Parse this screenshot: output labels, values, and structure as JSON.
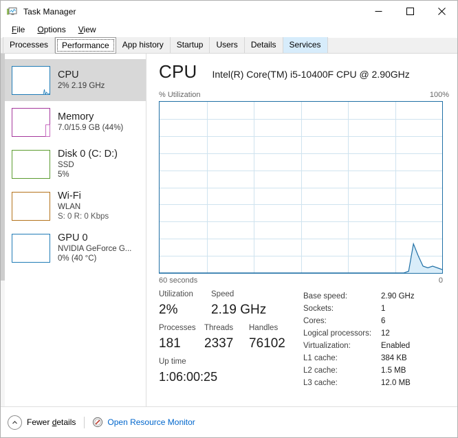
{
  "window": {
    "title": "Task Manager",
    "icon": "task-manager-icon",
    "minimize": "—",
    "maximize": "□",
    "close": "✕"
  },
  "menu": [
    {
      "label": "File",
      "accel": "F"
    },
    {
      "label": "Options",
      "accel": "O"
    },
    {
      "label": "View",
      "accel": "V"
    }
  ],
  "tabs": [
    {
      "label": "Processes",
      "state": "normal"
    },
    {
      "label": "Performance",
      "state": "active"
    },
    {
      "label": "App history",
      "state": "normal"
    },
    {
      "label": "Startup",
      "state": "normal"
    },
    {
      "label": "Users",
      "state": "normal"
    },
    {
      "label": "Details",
      "state": "normal"
    },
    {
      "label": "Services",
      "state": "hover"
    }
  ],
  "sidebar": {
    "items": [
      {
        "name": "CPU",
        "line2": "2%  2.19 GHz",
        "line3": "",
        "color": "#1f7bb6",
        "selected": true
      },
      {
        "name": "Memory",
        "line2": "7.0/15.9 GB (44%)",
        "line3": "",
        "color": "#a4379c",
        "selected": false
      },
      {
        "name": "Disk 0 (C: D:)",
        "line2": "SSD",
        "line3": "5%",
        "color": "#5b9b2e",
        "selected": false
      },
      {
        "name": "Wi-Fi",
        "line2": "WLAN",
        "line3": "S: 0 R: 0 Kbps",
        "color": "#b4721a",
        "selected": false
      },
      {
        "name": "GPU 0",
        "line2": "NVIDIA GeForce G...",
        "line3": "0%  (40 °C)",
        "color": "#1f7bb6",
        "selected": false
      }
    ]
  },
  "main": {
    "title": "CPU",
    "subtitle": "Intel(R) Core(TM) i5-10400F CPU @ 2.90GHz",
    "axis_label": "% Utilization",
    "axis_max": "100%",
    "time_left": "60 seconds",
    "time_right": "0",
    "accent_color": "#1f6fa5",
    "fill_color": "#d9edf9"
  },
  "chart_data": {
    "type": "area",
    "title": "CPU % Utilization",
    "xlabel": "60 seconds",
    "ylabel": "% Utilization",
    "ylim": [
      0,
      100
    ],
    "xlim": [
      60,
      0
    ],
    "grid": true,
    "grid_cols": 6,
    "grid_rows": 10,
    "legend": "none",
    "series": [
      {
        "name": "CPU utilization",
        "values": [
          0,
          0,
          0,
          0,
          0,
          0,
          0,
          0,
          0,
          0,
          0,
          0,
          0,
          0,
          0,
          0,
          0,
          0,
          0,
          0,
          0,
          0,
          0,
          0,
          0,
          0,
          0,
          0,
          0,
          0,
          0,
          0,
          0,
          0,
          0,
          0,
          0,
          0,
          0,
          0,
          0,
          0,
          0,
          0,
          0,
          0,
          0,
          0,
          0,
          0,
          0,
          0,
          1,
          17,
          10,
          4,
          3,
          4,
          3,
          2
        ]
      }
    ]
  },
  "stats": {
    "groups": [
      [
        {
          "label": "Utilization",
          "value": "2%"
        },
        {
          "label": "Speed",
          "value": "2.19 GHz"
        }
      ],
      [
        {
          "label": "Processes",
          "value": "181"
        },
        {
          "label": "Threads",
          "value": "2337"
        },
        {
          "label": "Handles",
          "value": "76102"
        }
      ],
      [
        {
          "label": "Up time",
          "value": "1:06:00:25"
        }
      ]
    ],
    "specs": [
      {
        "label": "Base speed:",
        "value": "2.90 GHz"
      },
      {
        "label": "Sockets:",
        "value": "1"
      },
      {
        "label": "Cores:",
        "value": "6"
      },
      {
        "label": "Logical processors:",
        "value": "12"
      },
      {
        "label": "Virtualization:",
        "value": "Enabled"
      },
      {
        "label": "L1 cache:",
        "value": "384 KB"
      },
      {
        "label": "L2 cache:",
        "value": "1.5 MB"
      },
      {
        "label": "L3 cache:",
        "value": "12.0 MB"
      }
    ]
  },
  "statusbar": {
    "fewer_details": "Fewer details",
    "fewer_accel": "d",
    "resource_monitor": "Open Resource Monitor"
  }
}
